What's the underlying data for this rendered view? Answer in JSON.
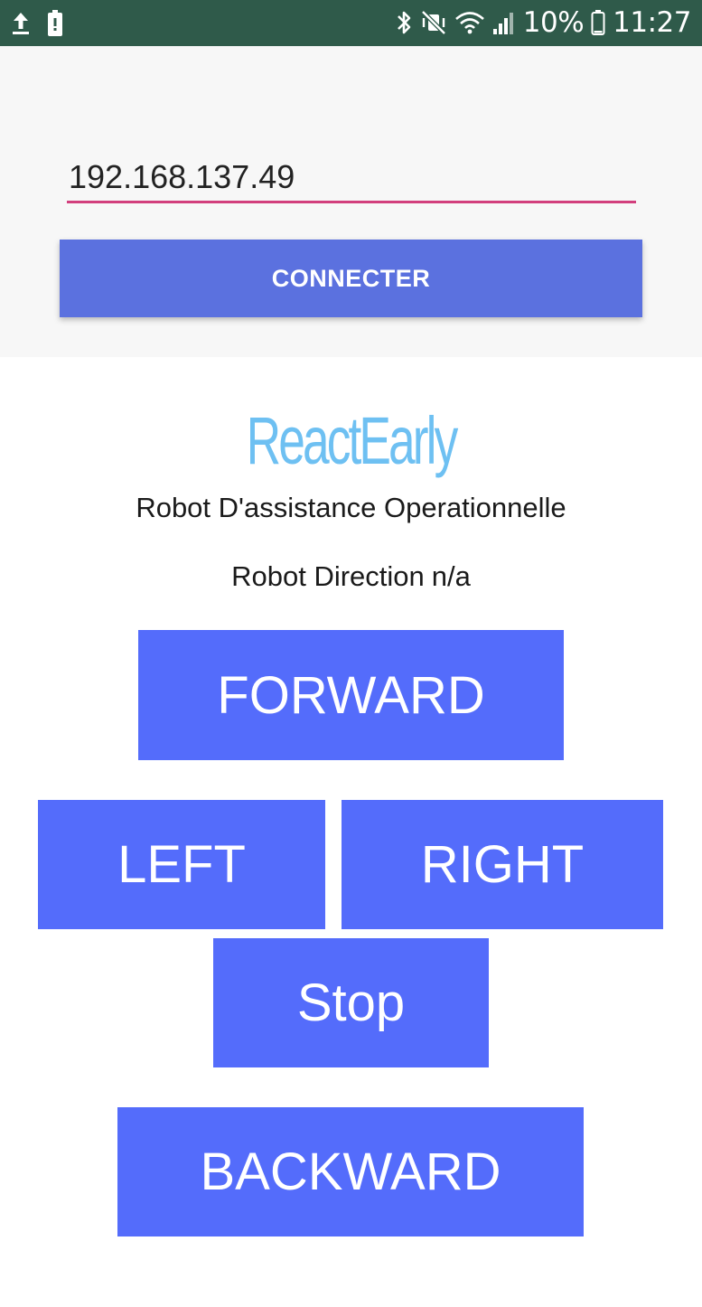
{
  "status_bar": {
    "upload_icon": "upload-arrow-icon",
    "battery_small_icon": "battery-icon",
    "bluetooth_icon": "bluetooth-icon",
    "mute_icon": "vibrate-mute-icon",
    "wifi_icon": "wifi-icon",
    "signal_icon": "cell-signal-icon",
    "battery_percent": "10%",
    "time": "11:27",
    "background_color": "#2f5a4a"
  },
  "connection": {
    "ip_value": "192.168.137.49",
    "connect_label": "CONNECTER",
    "accent_underline": "#d23f7d",
    "button_color": "#5b71df"
  },
  "brand": {
    "logo_text": "ReactEarly",
    "logo_color": "#6ec0f2",
    "subtitle": "Robot D'assistance Operationnelle"
  },
  "status": {
    "direction_label": "Robot Direction",
    "direction_value": "n/a"
  },
  "controls": {
    "forward_label": "FORWARD",
    "left_label": "LEFT",
    "right_label": "RIGHT",
    "stop_label": "Stop",
    "backward_label": "BACKWARD",
    "button_color": "#546cfb"
  }
}
